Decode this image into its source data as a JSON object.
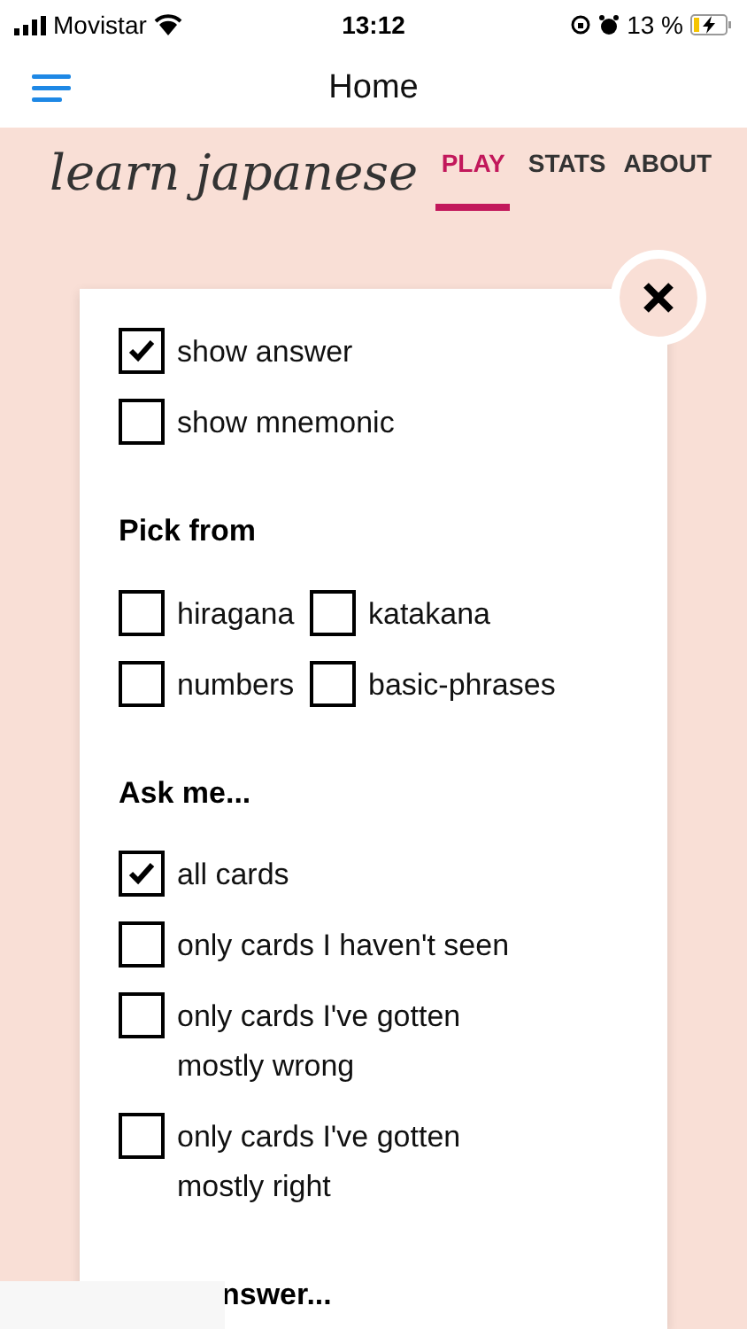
{
  "status_bar": {
    "carrier": "Movistar",
    "time": "13:12",
    "battery": "13 %"
  },
  "nav": {
    "title": "Home"
  },
  "logo": "learn japanese",
  "tabs": [
    {
      "label": "PLAY",
      "selected": true
    },
    {
      "label": "STATS",
      "selected": false
    },
    {
      "label": "ABOUT",
      "selected": false
    }
  ],
  "display_options": [
    {
      "label": "show answer",
      "checked": true
    },
    {
      "label": "show mnemonic",
      "checked": false
    }
  ],
  "pick_from": {
    "heading": "Pick from",
    "options": [
      {
        "label": "hiragana",
        "checked": false
      },
      {
        "label": "katakana",
        "checked": false
      },
      {
        "label": "numbers",
        "checked": false
      },
      {
        "label": "basic-phrases",
        "checked": false
      }
    ]
  },
  "ask_me": {
    "heading": "Ask me...",
    "options": [
      {
        "label": "all cards",
        "checked": true
      },
      {
        "label": "only cards I haven't seen",
        "checked": false
      },
      {
        "label": "only cards I've gotten mostly wrong",
        "checked": false
      },
      {
        "label": "only cards I've gotten mostly right",
        "checked": false
      }
    ]
  },
  "next_heading": "nswer..."
}
